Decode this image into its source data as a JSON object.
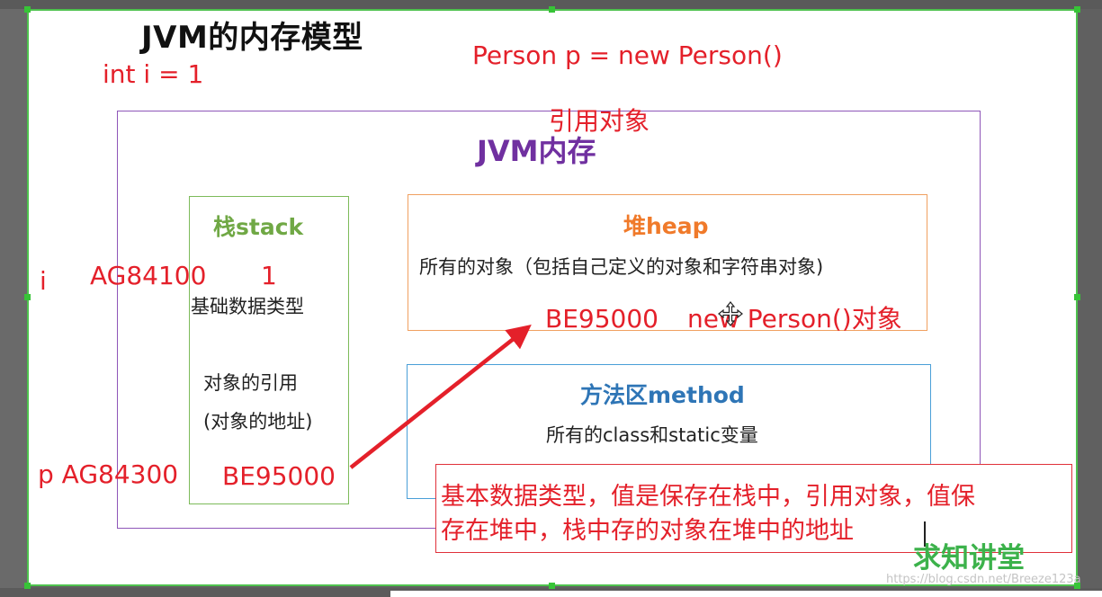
{
  "slide": {
    "title": "JVM的内存模型",
    "code_int": "int i = 1",
    "code_person": "Person p = new Person()",
    "reference_object_label": "引用对象",
    "jvm_memory_label": "JVM内存"
  },
  "stack": {
    "title": "栈stack",
    "basic_types": "基础数据类型",
    "object_ref": "对象的引用",
    "object_addr": "(对象的地址)"
  },
  "heap": {
    "title": "堆heap",
    "description": "所有的对象（包括自己定义的对象和字符串对象)"
  },
  "method_area": {
    "title": "方法区method",
    "description": "所有的class和static变量"
  },
  "annotations": {
    "var_i": "i",
    "addr_i": "AG84100",
    "value_i": "1",
    "var_p_addr": "p AG84300",
    "stack_value_p": "BE95000",
    "heap_addr": "BE95000",
    "heap_object": "new Person()对象"
  },
  "note": {
    "line1": "基本数据类型，值是保存在栈中，引用对象，值保",
    "line2": "存在堆中，栈中存的对象在堆中的地址"
  },
  "branding": {
    "logo": "求知讲堂",
    "watermark": "https://blog.csdn.net/Breeze123a"
  },
  "colors": {
    "annotation_red": "#e4202a",
    "jvm_purple": "#7030a0",
    "stack_green": "#70a845",
    "heap_orange": "#f07a2a",
    "method_blue": "#2e75b6",
    "selection_green": "#4ec24e"
  }
}
